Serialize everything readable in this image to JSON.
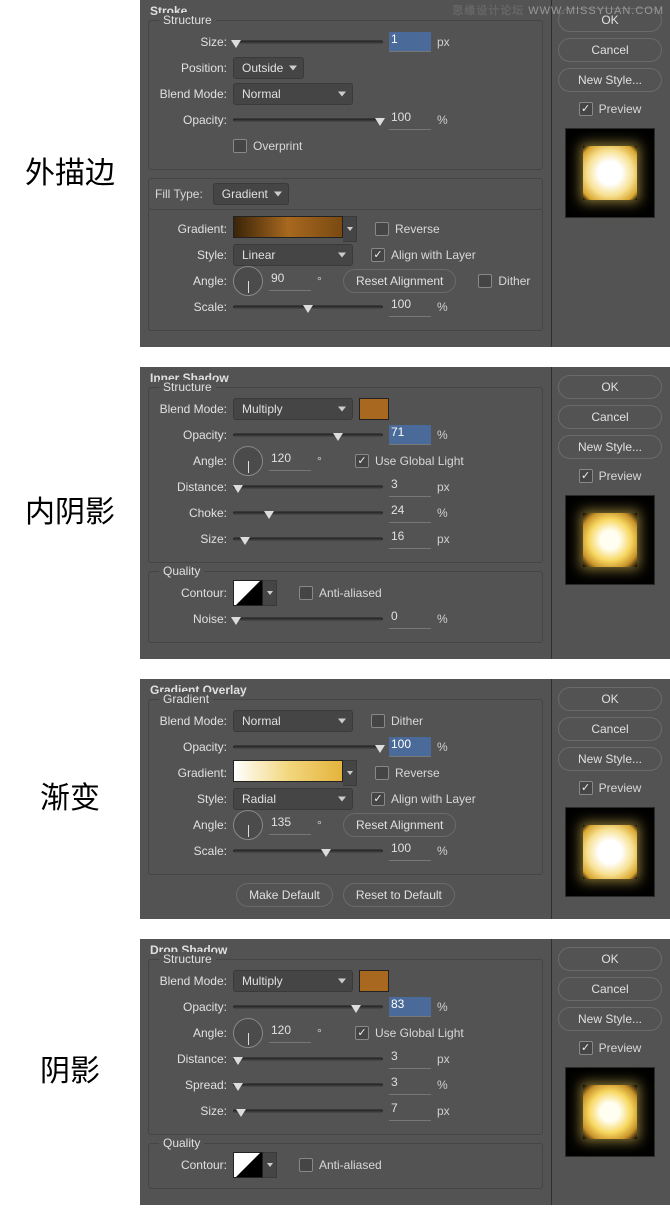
{
  "watermark": {
    "brand": "思缘设计论坛",
    "url": "WWW.MISSYUAN.COM"
  },
  "panels": [
    {
      "id": "stroke",
      "chinese": "外描边",
      "title": "Stroke",
      "sections": [
        {
          "legend": "Structure",
          "rows": [
            {
              "label": "Size:",
              "slider": 2,
              "value": "1",
              "unit": "px",
              "sel": true
            },
            {
              "label": "Position:",
              "select": "Outside"
            },
            {
              "label": "Blend Mode:",
              "select": "Normal",
              "wide": true
            },
            {
              "label": "Opacity:",
              "slider": 98,
              "value": "100",
              "unit": "%"
            },
            {
              "label": "",
              "checkbox": false,
              "check_label": "Overprint"
            }
          ]
        }
      ],
      "filltype": {
        "label": "Fill Type:",
        "select": "Gradient"
      },
      "grad_section": {
        "rows": [
          {
            "label": "Gradient:",
            "grad": "linear-gradient(90deg,#3a2408,#a8681f,#7a4a12)",
            "cb": false,
            "cblabel": "Reverse"
          },
          {
            "label": "Style:",
            "select": "Linear",
            "wide": true,
            "cb": true,
            "cblabel": "Align with Layer"
          },
          {
            "label": "Angle:",
            "dial": 0,
            "value": "90",
            "unit": "°",
            "btn": "Reset Alignment",
            "cb2": false,
            "cb2label": "Dither"
          },
          {
            "label": "Scale:",
            "slider": 50,
            "value": "100",
            "unit": "%"
          }
        ]
      },
      "buttons": {
        "ok": "OK",
        "cancel": "Cancel",
        "new": "New Style...",
        "preview": "Preview"
      },
      "thumb": "soft"
    },
    {
      "id": "inner",
      "chinese": "内阴影",
      "title": "Inner Shadow",
      "sections": [
        {
          "legend": "Structure",
          "rows": [
            {
              "label": "Blend Mode:",
              "select": "Multiply",
              "wide": true,
              "swatch": "#a8681f"
            },
            {
              "label": "Opacity:",
              "slider": 70,
              "value": "71",
              "unit": "%",
              "sel": true
            },
            {
              "label": "Angle:",
              "dial": -30,
              "value": "120",
              "unit": "°",
              "cb": true,
              "cblabel": "Use Global Light"
            },
            {
              "label": "Distance:",
              "slider": 3,
              "value": "3",
              "unit": "px"
            },
            {
              "label": "Choke:",
              "slider": 24,
              "value": "24",
              "unit": "%"
            },
            {
              "label": "Size:",
              "slider": 8,
              "value": "16",
              "unit": "px"
            }
          ]
        },
        {
          "legend": "Quality",
          "rows": [
            {
              "label": "Contour:",
              "contour": true,
              "cb": false,
              "cblabel": "Anti-aliased"
            },
            {
              "label": "Noise:",
              "slider": 2,
              "value": "0",
              "unit": "%"
            }
          ]
        }
      ],
      "buttons": {
        "ok": "OK",
        "cancel": "Cancel",
        "new": "New Style...",
        "preview": "Preview"
      },
      "thumb": "normal"
    },
    {
      "id": "gradov",
      "chinese": "渐变",
      "title": "Gradient Overlay",
      "sections": [
        {
          "legend": "Gradient",
          "rows": [
            {
              "label": "Blend Mode:",
              "select": "Normal",
              "wide": true,
              "cb": false,
              "cblabel": "Dither"
            },
            {
              "label": "Opacity:",
              "slider": 98,
              "value": "100",
              "unit": "%",
              "sel": true
            },
            {
              "label": "Gradient:",
              "grad": "linear-gradient(90deg,#ffffff,#f2d77e,#e4b43c)",
              "cb": false,
              "cblabel": "Reverse"
            },
            {
              "label": "Style:",
              "select": "Radial",
              "wide": true,
              "cb": true,
              "cblabel": "Align with Layer"
            },
            {
              "label": "Angle:",
              "dial": -45,
              "value": "135",
              "unit": "°",
              "btn": "Reset Alignment"
            },
            {
              "label": "Scale:",
              "slider": 62,
              "value": "100",
              "unit": "%"
            }
          ]
        }
      ],
      "footer_buttons": [
        "Make Default",
        "Reset to Default"
      ],
      "buttons": {
        "ok": "OK",
        "cancel": "Cancel",
        "new": "New Style...",
        "preview": "Preview"
      },
      "thumb": "soft"
    },
    {
      "id": "drop",
      "chinese": "阴影",
      "title": "Drop Shadow",
      "sections": [
        {
          "legend": "Structure",
          "rows": [
            {
              "label": "Blend Mode:",
              "select": "Multiply",
              "wide": true,
              "swatch": "#a8681f"
            },
            {
              "label": "Opacity:",
              "slider": 82,
              "value": "83",
              "unit": "%",
              "sel": true
            },
            {
              "label": "Angle:",
              "dial": -30,
              "value": "120",
              "unit": "°",
              "cb": true,
              "cblabel": "Use Global Light"
            },
            {
              "label": "Distance:",
              "slider": 3,
              "value": "3",
              "unit": "px"
            },
            {
              "label": "Spread:",
              "slider": 3,
              "value": "3",
              "unit": "%"
            },
            {
              "label": "Size:",
              "slider": 5,
              "value": "7",
              "unit": "px"
            }
          ]
        },
        {
          "legend": "Quality",
          "rows": [
            {
              "label": "Contour:",
              "contour": true,
              "cb": false,
              "cblabel": "Anti-aliased"
            }
          ]
        }
      ],
      "buttons": {
        "ok": "OK",
        "cancel": "Cancel",
        "new": "New Style...",
        "preview": "Preview"
      },
      "thumb": "normal"
    }
  ]
}
